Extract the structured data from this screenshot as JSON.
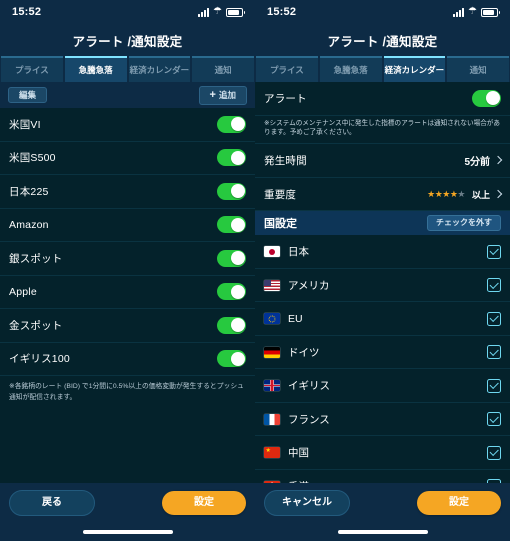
{
  "colors": {
    "nav_bg": "#0d2b45",
    "list_bg": "#04222b",
    "toggle_on": "#27c93f",
    "accent_orange": "#f5a623",
    "tab_active_border": "#7fe3ff",
    "checkbox": "#6fd8f0",
    "section_bg": "#0d3557",
    "scroll_hint": "#d64b4b"
  },
  "status_bar": {
    "time": "15:52",
    "signal_icon": "signal-bars-icon",
    "wifi_icon": "wifi-icon",
    "battery_icon": "battery-icon"
  },
  "left": {
    "title": "アラート /通知設定",
    "tabs": [
      {
        "label": "プライス",
        "active": false
      },
      {
        "label": "急騰急落",
        "active": true
      },
      {
        "label": "経済カレンダー",
        "active": false
      },
      {
        "label": "通知",
        "active": false
      }
    ],
    "actions": {
      "edit_label": "編集",
      "add_label": "追加",
      "add_icon": "plus-icon"
    },
    "items": [
      {
        "label": "米国VI",
        "enabled": true
      },
      {
        "label": "米国S500",
        "enabled": true
      },
      {
        "label": "日本225",
        "enabled": true
      },
      {
        "label": "Amazon",
        "enabled": true
      },
      {
        "label": "銀スポット",
        "enabled": true
      },
      {
        "label": "Apple",
        "enabled": true
      },
      {
        "label": "金スポット",
        "enabled": true
      },
      {
        "label": "イギリス100",
        "enabled": true
      }
    ],
    "footnote": "※各銘柄のレート (BID) で1分間に0.5%以上の価格変動が発生するとプッシュ通知が配信されます。",
    "buttons": {
      "back_label": "戻る",
      "submit_label": "設定"
    }
  },
  "right": {
    "title": "アラート /通知設定",
    "tabs": [
      {
        "label": "プライス",
        "active": false
      },
      {
        "label": "急騰急落",
        "active": false
      },
      {
        "label": "経済カレンダー",
        "active": true
      },
      {
        "label": "通知",
        "active": false
      }
    ],
    "alert_row": {
      "label": "アラート",
      "enabled": true
    },
    "alert_note": "※システムのメンテナンス中に発生した指標のアラートは通知されない場合があります。予めご了承ください。",
    "settings": [
      {
        "label": "発生時間",
        "value": "5分前",
        "type": "text"
      },
      {
        "label": "重要度",
        "value": "以上",
        "type": "stars",
        "stars_on": 4,
        "stars_total": 5
      }
    ],
    "country_section": {
      "title": "国設定",
      "clear_label": "チェックを外す"
    },
    "countries": [
      {
        "label": "日本",
        "flag": "flag-jp",
        "checked": true
      },
      {
        "label": "アメリカ",
        "flag": "flag-us",
        "checked": true
      },
      {
        "label": "EU",
        "flag": "flag-eu",
        "checked": true
      },
      {
        "label": "ドイツ",
        "flag": "flag-de",
        "checked": true
      },
      {
        "label": "イギリス",
        "flag": "flag-gb",
        "checked": true
      },
      {
        "label": "フランス",
        "flag": "flag-fr",
        "checked": true
      },
      {
        "label": "中国",
        "flag": "flag-cn",
        "checked": true
      },
      {
        "label": "香港",
        "flag": "flag-hk",
        "checked": true,
        "scroll_hint": "⌄"
      }
    ],
    "buttons": {
      "cancel_label": "キャンセル",
      "submit_label": "設定"
    }
  }
}
